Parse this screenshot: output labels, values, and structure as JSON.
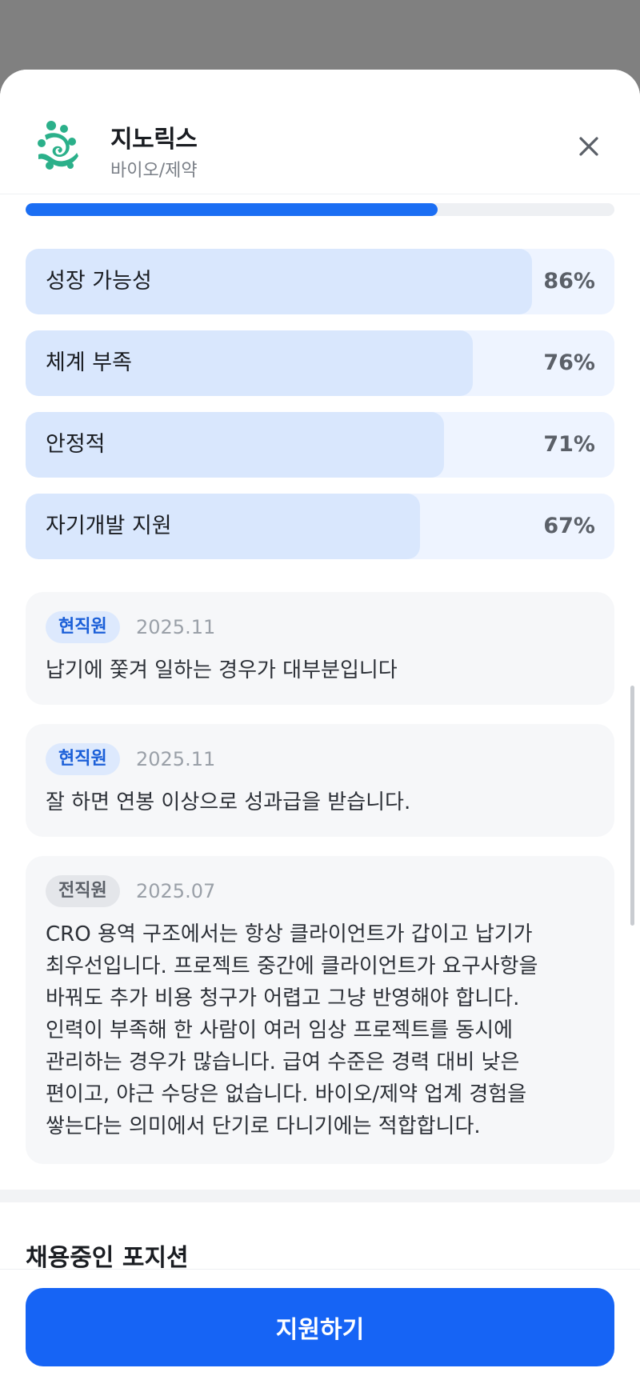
{
  "company": {
    "name": "지노릭스",
    "category": "바이오/제약"
  },
  "overall_progress": 0.7,
  "ratings": [
    {
      "label": "성장 가능성",
      "percent": 86,
      "percent_text": "86%"
    },
    {
      "label": "체계 부족",
      "percent": 76,
      "percent_text": "76%"
    },
    {
      "label": "안정적",
      "percent": 71,
      "percent_text": "71%"
    },
    {
      "label": "자기개발 지원",
      "percent": 67,
      "percent_text": "67%"
    }
  ],
  "reviews": [
    {
      "badge": "현직원",
      "badge_type": "current",
      "date": "2025.11",
      "lines": [
        "납기에 쫓겨 일하는 경우가 대부분입니다"
      ]
    },
    {
      "badge": "현직원",
      "badge_type": "current",
      "date": "2025.11",
      "lines": [
        "잘 하면 연봉 이상으로 성과급을 받습니다."
      ]
    },
    {
      "badge": "전직원",
      "badge_type": "former",
      "date": "2025.07",
      "lines": [
        "CRO 용역 구조에서는 항상 클라이언트가 갑이고 납기가",
        "최우선입니다. 프로젝트 중간에 클라이언트가 요구사항을",
        "바꿔도 추가 비용 청구가 어렵고 그냥 반영해야 합니다.",
        "인력이 부족해 한 사람이 여러 임상 프로젝트를 동시에",
        "관리하는 경우가 많습니다. 급여 수준은 경력 대비 낮은",
        "편이고, 야근 수당은 없습니다. 바이오/제약 업계 경험을",
        "쌓는다는 의미에서 단기로 다니기에는 적합합니다."
      ]
    }
  ],
  "open_positions_title": "채용중인 포지션",
  "apply_label": "지원하기",
  "colors": {
    "accent": "#1664f5",
    "progress": "#1b6ef3",
    "logo": "#2bb08a"
  }
}
